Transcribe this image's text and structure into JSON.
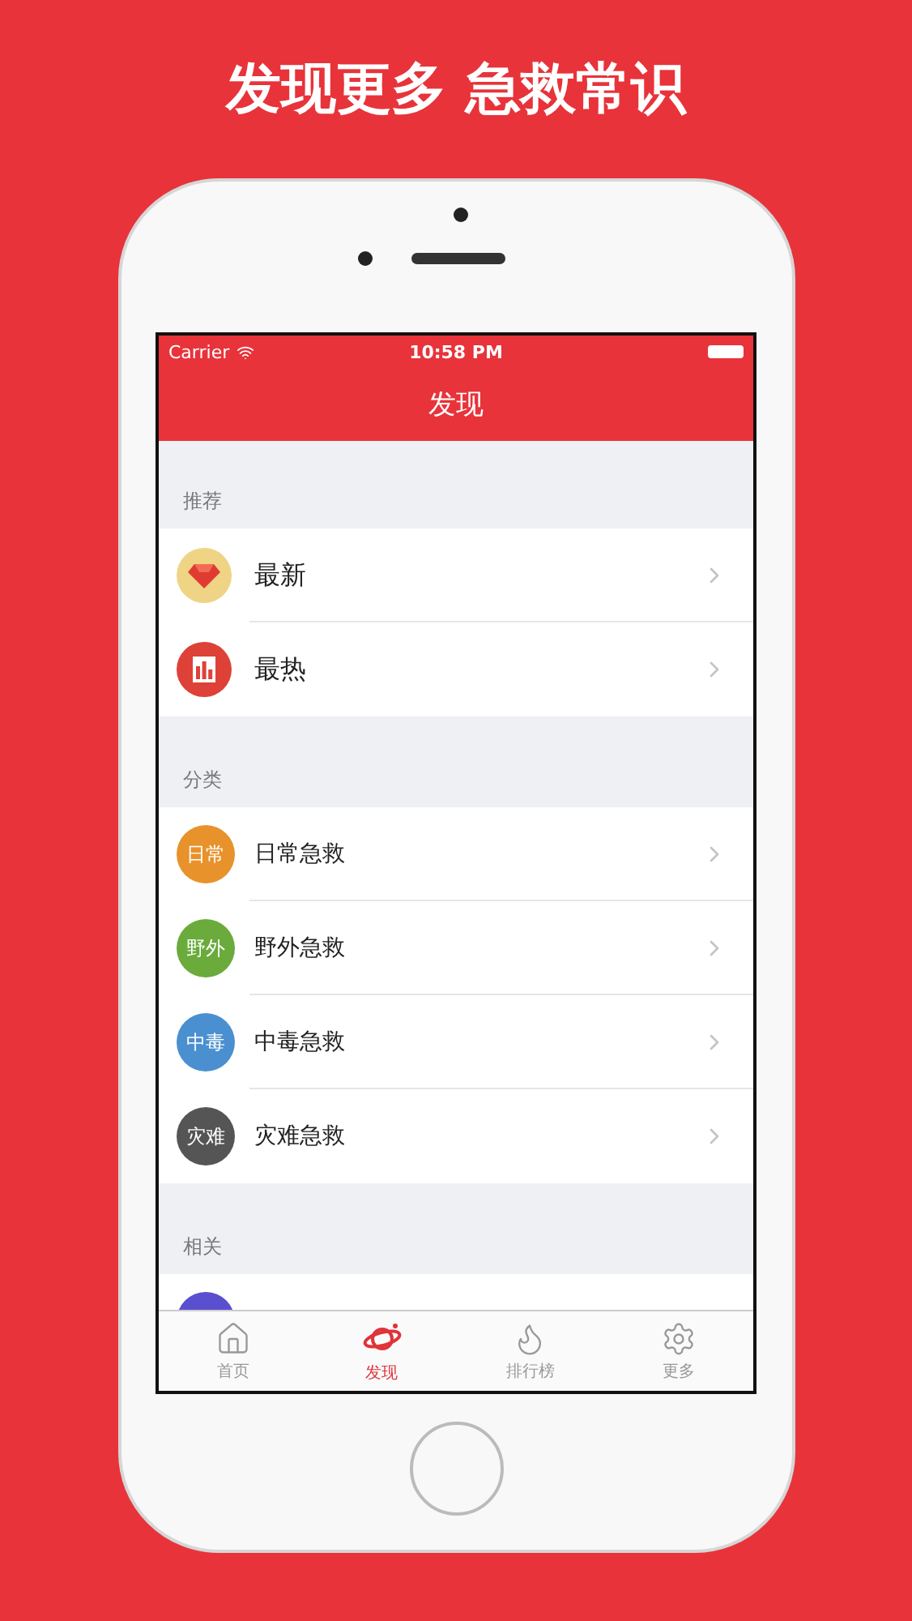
{
  "headline": "发现更多 急救常识",
  "status_bar": {
    "carrier": "Carrier",
    "time": "10:58 PM"
  },
  "nav": {
    "title": "发现"
  },
  "sections": [
    {
      "header": "推荐",
      "rows": [
        {
          "kind": "gem",
          "label": "最新",
          "color": "#efd486"
        },
        {
          "kind": "chart",
          "label": "最热",
          "color": "#de4138"
        }
      ]
    },
    {
      "header": "分类",
      "rows": [
        {
          "kind": "text",
          "badge": "日常",
          "label": "日常急救",
          "color": "#e8922c"
        },
        {
          "kind": "text",
          "badge": "野外",
          "label": "野外急救",
          "color": "#6aab3c"
        },
        {
          "kind": "text",
          "badge": "中毒",
          "label": "中毒急救",
          "color": "#4a90d0"
        },
        {
          "kind": "text",
          "badge": "灾难",
          "label": "灾难急救",
          "color": "#555555"
        }
      ]
    },
    {
      "header": "相关",
      "rows": [
        {
          "kind": "text",
          "color": "#5a4fcf"
        }
      ]
    }
  ],
  "tabs": [
    {
      "kind": "home",
      "label": "首页",
      "selected": false
    },
    {
      "kind": "planet",
      "label": "发现",
      "selected": true
    },
    {
      "kind": "flame",
      "label": "排行榜",
      "selected": false
    },
    {
      "kind": "gear",
      "label": "更多",
      "selected": false
    }
  ]
}
